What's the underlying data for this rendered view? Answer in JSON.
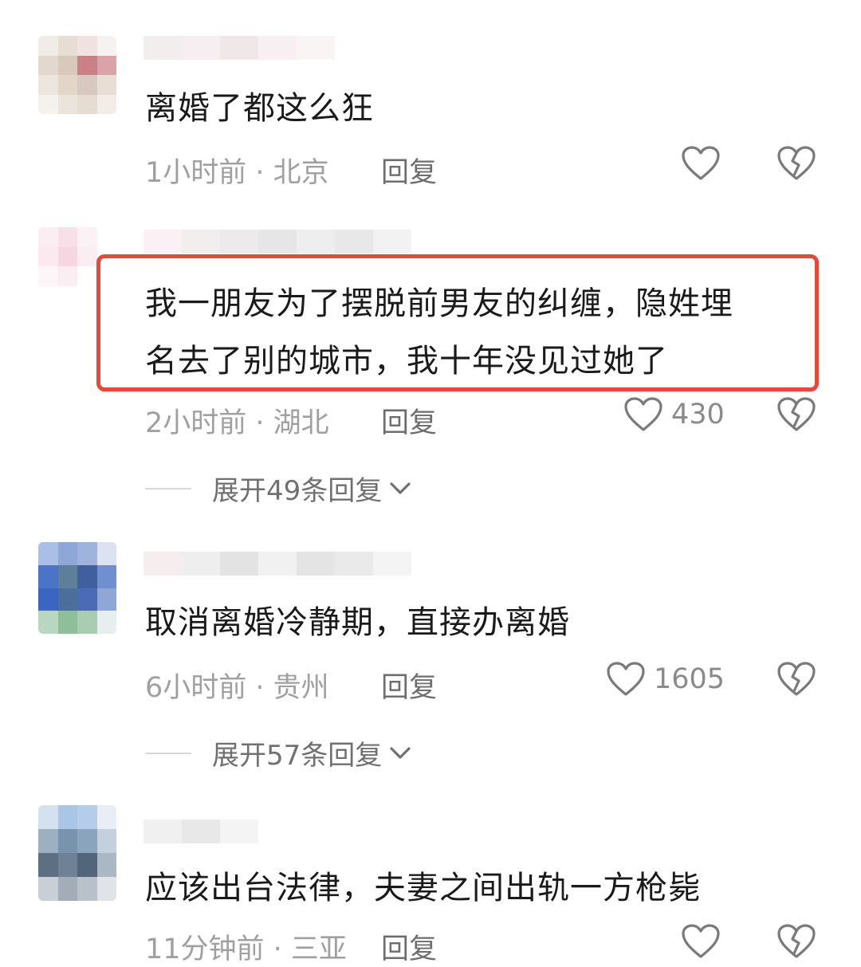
{
  "comments": [
    {
      "text": "离婚了都这么狂",
      "meta": "1小时前 · 北京",
      "reply": "回复",
      "likes": ""
    },
    {
      "text_line1": "我一朋友为了摆脱前男友的纠缠，隐姓埋",
      "text_line2": "名去了别的城市，我十年没见过她了",
      "meta": "2小时前 · 湖北",
      "reply": "回复",
      "likes": "430",
      "expand": "展开49条回复"
    },
    {
      "text": "取消离婚冷静期，直接办离婚",
      "meta": "6小时前 · 贵州",
      "reply": "回复",
      "likes": "1605",
      "expand": "展开57条回复"
    },
    {
      "text": "应该出台法律，夫妻之间出轨一方枪毙",
      "meta": "11分钟前 · 三亚",
      "reply": "回复"
    }
  ],
  "colors": {
    "highlight_border": "#e8473a",
    "text": "#1a1a1a",
    "meta": "#a0a0a0"
  },
  "icons": [
    "heart-icon",
    "broken-heart-icon",
    "chevron-down-icon"
  ]
}
